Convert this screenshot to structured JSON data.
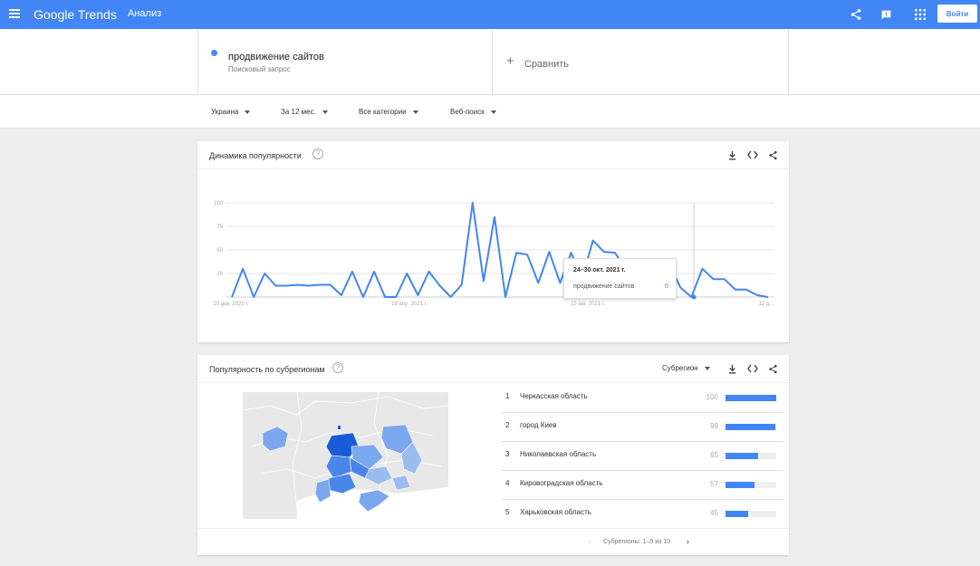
{
  "header": {
    "logo_text": "Google Trends",
    "section": "Анализ",
    "signin_label": "Войти",
    "icons": [
      "menu-icon",
      "share-icon",
      "feedback-icon",
      "apps-icon"
    ],
    "bg_color": "#4285f4"
  },
  "terms": {
    "term_name": "продвижение сайтов",
    "term_sub": "Поисковый запрос",
    "term_color": "#4285f4",
    "compare_label": "Сравнить"
  },
  "filters": {
    "region": "Украина",
    "period": "За 12 мес.",
    "category": "Все категории",
    "search_type": "Веб-поиск"
  },
  "interest_card": {
    "title": "Динамика популярности",
    "tooltip": {
      "date": "24–30 окт. 2021 г.",
      "term": "продвижение сайтов",
      "value": "0"
    }
  },
  "chart_data": {
    "type": "line",
    "ylim": [
      0,
      100
    ],
    "yticks": [
      "100",
      "75",
      "50",
      "25"
    ],
    "xticks": [
      "20 дек. 2020 г.",
      "18 апр. 2021 г.",
      "15 авг. 2021 г.",
      "12 д..."
    ],
    "series": [
      {
        "color": "#4285f4",
        "values": [
          0,
          30,
          0,
          25,
          12,
          12,
          13,
          12,
          13,
          13,
          2,
          27,
          0,
          27,
          0,
          0,
          25,
          2,
          27,
          12,
          0,
          13,
          100,
          17,
          85,
          0,
          47,
          45,
          15,
          48,
          15,
          47,
          20,
          60,
          48,
          47,
          30,
          10,
          0,
          10,
          35,
          10,
          0,
          30,
          19,
          19,
          8,
          8,
          2,
          0
        ]
      }
    ]
  },
  "region_card": {
    "title": "Популярность по субрегионам",
    "select_label": "Субрегион",
    "map_shades": [
      "#1a5cd8",
      "#4a86e8",
      "#7aa7ee",
      "#9bbcf0"
    ],
    "rows": [
      {
        "rank": "1",
        "name": "Черкасская область",
        "value": "100",
        "pct": 100
      },
      {
        "rank": "2",
        "name": "город Киев",
        "value": "98",
        "pct": 98
      },
      {
        "rank": "3",
        "name": "Николаевская область",
        "value": "65",
        "pct": 65
      },
      {
        "rank": "4",
        "name": "Кировоградская область",
        "value": "57",
        "pct": 57
      },
      {
        "rank": "5",
        "name": "Харьковская область",
        "value": "45",
        "pct": 45
      }
    ],
    "pager_label": "Субрегионы: 1–5 из 10"
  }
}
